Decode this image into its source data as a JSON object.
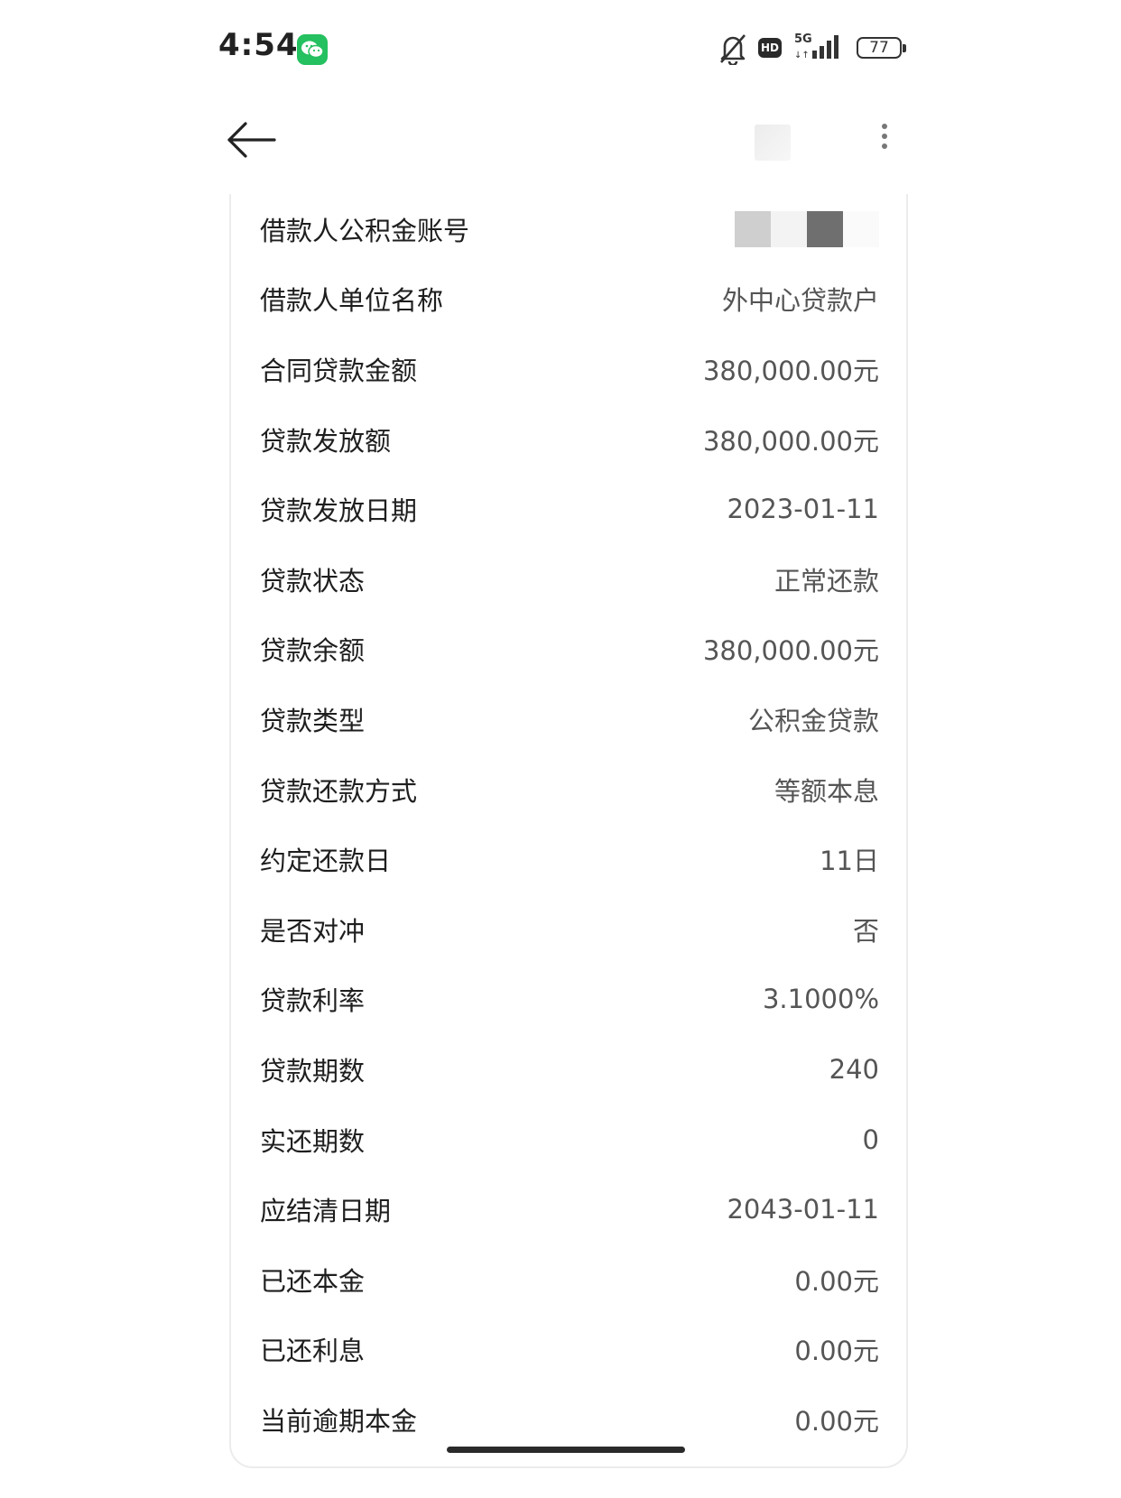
{
  "status_bar": {
    "time": "4:54",
    "network_label": "5G",
    "hd_label": "HD",
    "battery_level": "77",
    "icons": [
      "wechat-icon",
      "mute-bell-icon",
      "hd-icon",
      "signal-icon",
      "battery-icon"
    ]
  },
  "top_bar": {
    "icons": [
      "back-arrow-icon",
      "more-vertical-icon"
    ]
  },
  "details": {
    "rows": [
      {
        "label": "借款人公积金账号",
        "value": ""
      },
      {
        "label": "借款人单位名称",
        "value": "外中心贷款户"
      },
      {
        "label": "合同贷款金额",
        "value": "380,000.00元"
      },
      {
        "label": "贷款发放额",
        "value": "380,000.00元"
      },
      {
        "label": "贷款发放日期",
        "value": "2023-01-11"
      },
      {
        "label": "贷款状态",
        "value": "正常还款"
      },
      {
        "label": "贷款余额",
        "value": "380,000.00元"
      },
      {
        "label": "贷款类型",
        "value": "公积金贷款"
      },
      {
        "label": "贷款还款方式",
        "value": "等额本息"
      },
      {
        "label": "约定还款日",
        "value": "11日"
      },
      {
        "label": "是否对冲",
        "value": "否"
      },
      {
        "label": "贷款利率",
        "value": "3.1000%"
      },
      {
        "label": "贷款期数",
        "value": "240"
      },
      {
        "label": "实还期数",
        "value": "0"
      },
      {
        "label": "应结清日期",
        "value": "2043-01-11"
      },
      {
        "label": "已还本金",
        "value": "0.00元"
      },
      {
        "label": "已还利息",
        "value": "0.00元"
      },
      {
        "label": "当前逾期本金",
        "value": "0.00元"
      }
    ]
  },
  "colors": {
    "background": "#ffffff",
    "label_text": "#1e1e1e",
    "value_text": "#555555",
    "wechat_green": "#25c05f"
  }
}
